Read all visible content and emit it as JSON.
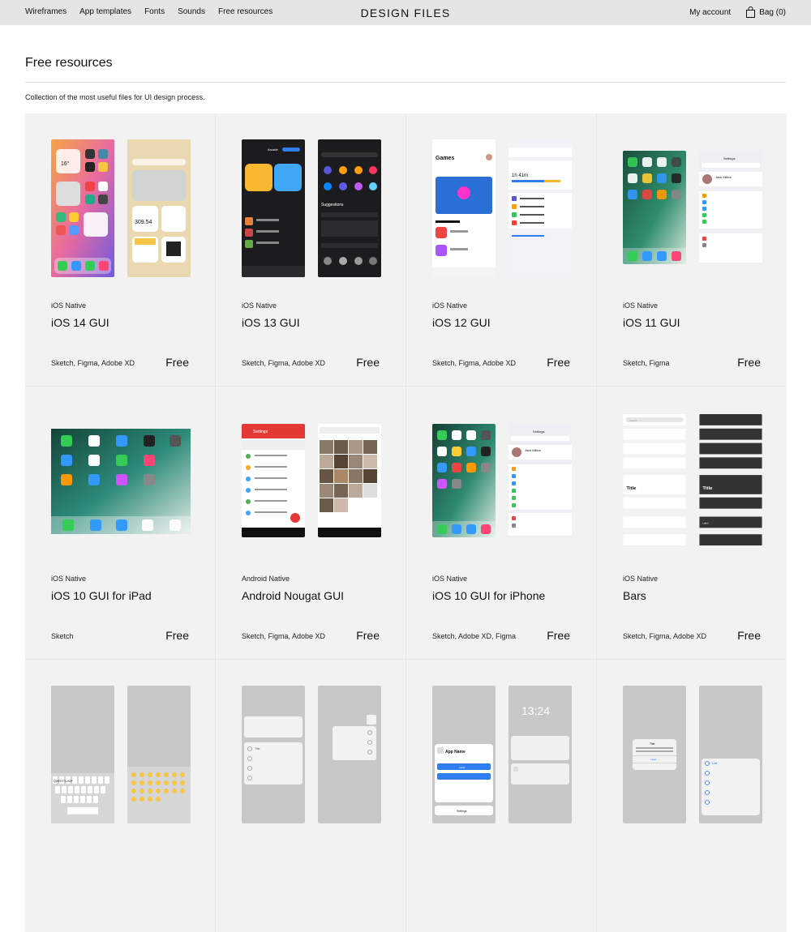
{
  "header": {
    "nav": [
      "Wireframes",
      "App templates",
      "Fonts",
      "Sounds",
      "Free resources"
    ],
    "brand": "DESIGN FILES",
    "account": "My account",
    "bag": "Bag (0)"
  },
  "page": {
    "title": "Free resources",
    "subtitle": "Collection of the most useful files for UI design process."
  },
  "colors": {
    "header_bg": "#e5e5e5",
    "card_bg": "#f2f2f2",
    "ios_blue": "#2f7ef5",
    "android_red": "#e53935"
  },
  "products": [
    {
      "category": "iOS Native",
      "title": "iOS 14 GUI",
      "tools": "Sketch, Figma, Adobe XD",
      "price": "Free"
    },
    {
      "category": "iOS Native",
      "title": "iOS 13 GUI",
      "tools": "Sketch, Figma, Adobe XD",
      "price": "Free"
    },
    {
      "category": "iOS Native",
      "title": "iOS 12 GUI",
      "tools": "Sketch, Figma, Adobe XD",
      "price": "Free"
    },
    {
      "category": "iOS Native",
      "title": "iOS 11 GUI",
      "tools": "Sketch, Figma",
      "price": "Free"
    },
    {
      "category": "iOS Native",
      "title": "iOS 10 GUI for iPad",
      "tools": "Sketch",
      "price": "Free"
    },
    {
      "category": "Android Native",
      "title": "Android Nougat GUI",
      "tools": "Sketch, Figma, Adobe XD",
      "price": "Free"
    },
    {
      "category": "iOS Native",
      "title": "iOS 10 GUI for iPhone",
      "tools": "Sketch, Adobe XD, Figma",
      "price": "Free"
    },
    {
      "category": "iOS Native",
      "title": "Bars",
      "tools": "Sketch, Figma, Adobe XD",
      "price": "Free"
    },
    {
      "category": "",
      "title": "",
      "tools": "",
      "price": ""
    },
    {
      "category": "",
      "title": "",
      "tools": "",
      "price": ""
    },
    {
      "category": "",
      "title": "",
      "tools": "",
      "price": ""
    },
    {
      "category": "",
      "title": "",
      "tools": "",
      "price": ""
    }
  ],
  "previews": {
    "ios14": {
      "time": "16°",
      "stock": "309.54"
    },
    "ios13": {
      "arcade": "Arcade",
      "suggestions": "Suggestions"
    },
    "ios12": {
      "games": "Games",
      "screen_time": "1h 41m"
    },
    "ios11": {
      "name": "Jack Milton",
      "settings": "Settings"
    },
    "android": {
      "settings": "Settings"
    },
    "ios10": {
      "name": "Jack Milton",
      "settings": "Settings"
    },
    "bars": {
      "title": "Title",
      "label": "Label",
      "search": "Search"
    },
    "keyboard": {
      "rows": [
        "QWERTYUIOP",
        "ASDFGHJKL",
        "ZXCVBNM"
      ]
    },
    "sheet": {
      "title": "Title"
    },
    "lockscreen": {
      "time": "13:24",
      "app_name": "App Name",
      "settings": "Settings",
      "label": "Label"
    },
    "alert": {
      "title": "Title",
      "label": "Label",
      "link": "Link"
    }
  }
}
